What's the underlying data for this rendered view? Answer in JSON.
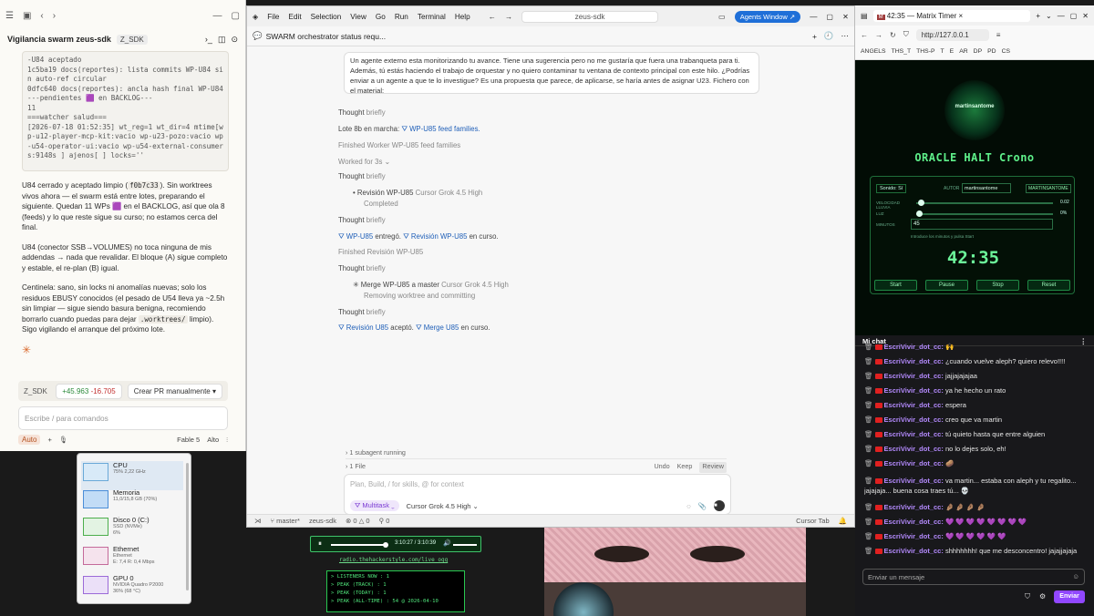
{
  "left": {
    "title": "Vigilancia swarm zeus-sdk",
    "branch_badge": "Z_SDK",
    "code_lines": "-U84 aceptado\n1c5ba19 docs(reportes): lista commits WP-U84 sin auto-ref circular\n0dfc640 docs(reportes): ancla hash final WP-U84\n---pendientes 🟪 en BACKLOG---\n11\n===watcher salud===\n[2026-07-18 01:52:35] wt_reg=1 wt_dir=4 mtime[wp-u12-player-mcp-kit:vacio wp-u23-pozo:vacio wp-u54-operator-ui:vacio wp-u54-external-consumers:9148s ] ajenos[ ] locks=''",
    "para1_a": "U84 cerrado y aceptado limpio (",
    "para1_code": "f0b7c33",
    "para1_b": "). Sin worktrees vivos ahora — el swarm está entre lotes, preparando el siguiente. Quedan 11 WPs 🟪 en el BACKLOG, así que ola 8 (feeds) y lo que reste sigue su curso; no estamos cerca del final.",
    "para2": "U84 (conector SSB→VOLUMES) no toca ninguna de mis addendas → nada que revalidar. El bloque (A) sigue completo y estable, el re-plan (B) igual.",
    "para3_a": "Centinela: sano, sin locks ni anomalías nuevas; solo los residuos EBUSY conocidos (el pesado de U54 lleva ya ~2.5h sin limpiar — sigue siendo basura benigna, recomiendo borrarlo cuando puedas para dejar ",
    "para3_code": ".worktrees/",
    "para3_b": " limpio). Sigo vigilando el arranque del próximo lote.",
    "repo_chip": "Z_SDK",
    "diff_add": "+45.963",
    "diff_del": "-16.705",
    "pr_button": "Crear PR manualmente",
    "input_placeholder": "Escribe / para comandos",
    "mode": "Auto",
    "model": "Fable 5",
    "effort": "Alto"
  },
  "mid": {
    "menu": [
      "File",
      "Edit",
      "Selection",
      "View",
      "Go",
      "Run",
      "Terminal",
      "Help"
    ],
    "search": "zeus-sdk",
    "agents_button": "Agents Window ↗",
    "tab_title": "SWARM orchestrator status requ...",
    "message": "Un agente externo esta monitorizando tu avance. Tiene una sugerencia pero no me gustaría que fuera una trabanqueta para ti. Además, tú estás haciendo el trabajo de orquestar y no quiero contaminar tu ventana de contexto principal con este hilo. ¿Podrías enviar a un agente a que te lo investigue? Es una propuesta que parece, de aplicarse, se haría antes de asignar U23. Fichero con el material:",
    "thought": "Thought",
    "briefly": "briefly",
    "lote_text": "Lote 8b en marcha:",
    "lote_link": "WP-U85 feed families.",
    "finished1": "Finished Worker WP-U85 feed families",
    "worked": "Worked for 3s",
    "rev_title": "Revisión WP-U85",
    "rev_model": "Cursor Grok 4.5 High",
    "rev_status": "Completed",
    "entrego_link1": "WP-U85",
    "entrego_text": "entregó.",
    "entrego_link2": "Revisión WP-U85",
    "entrego_tail": "en curso.",
    "finished2": "Finished Revisión WP-U85",
    "merge_title": "Merge WP-U85 a master",
    "merge_model": "Cursor Grok 4.5 High",
    "merge_status": "Removing worktree and committing",
    "acepto_link1": "Revisión U85",
    "acepto_text": "aceptó.",
    "acepto_link2": "Merge U85",
    "acepto_tail": "en curso.",
    "subagent": "1 subagent running",
    "files": "1 File",
    "undo": "Undo",
    "keep": "Keep",
    "review": "Review",
    "composer_placeholder": "Plan, Build, / for skills, @ for context",
    "multitask": "Multitask",
    "composer_model": "Cursor Grok 4.5 High",
    "status_branch": "master*",
    "status_repo": "zeus-sdk",
    "status_errors": "⊗ 0 △ 0",
    "status_ports": "0",
    "status_right": "Cursor Tab"
  },
  "right": {
    "tab_title": "42:35 — Matrix Timer",
    "url": "http://127.0.0.1",
    "bookmarks": [
      "ANGELS",
      "THS_T",
      "THS-P",
      "T",
      "E",
      "AR",
      "DP",
      "PD",
      "CS"
    ],
    "avatar_name": "martinsantome",
    "crono_title": "ORACLE HALT Crono",
    "sonido": "Sonido: Sí",
    "autor_label": "AUTOR",
    "autor_value": "martinsantome",
    "autor_tag": "MARTINSANTOME",
    "velocidad": "VELOCIDAD LLUVIA",
    "vel_value": "0.02",
    "luz": "LUZ",
    "luz_value": "0%",
    "minutos": "MINUTOS",
    "min_value": "45",
    "hint": "Introduce los minutos y pulsa Start",
    "timer": "42:35",
    "buttons": [
      "Start",
      "Pause",
      "Stop",
      "Reset"
    ],
    "chat_title": "Mi chat",
    "user": "EscriVivir_dot_cc:",
    "messages": [
      "🙌",
      "¿cuando vuelve aleph? quiero relevo!!!!",
      "jajjajajajaa",
      "ya he hecho un rato",
      "espera",
      "creo que va martin",
      "tú quieto hasta que entre alguien",
      "no lo dejes solo, eh!",
      "🥔",
      "va martin... estaba con aleph y tu regalito... jajajaja... buena cosa traes tú... 💀",
      "🤌🏽 🤌🏽 🤌🏽 🤌🏽",
      "💜 💜 💜 💜 💜 💜 💜 💜",
      "💜 💜 💜 💜 💜 💜",
      "shhhhhhh! que me desconcentro! jajajjajaja"
    ],
    "chat_placeholder": "Enviar un mensaje",
    "send": "Enviar"
  },
  "taskman": {
    "items": [
      {
        "name": "CPU",
        "sub": "75% 2,22 GHz"
      },
      {
        "name": "Memoria",
        "sub": "11,0/15,8 GB (70%)"
      },
      {
        "name": "Disco 0 (C:)",
        "sub": "SSD (NVMe)\n6%"
      },
      {
        "name": "Ethernet",
        "sub": "Ethernet\nE: 7,4 R: 0,4 Mbps"
      },
      {
        "name": "GPU 0",
        "sub": "NVIDIA Quadro P2000\n36% (68 °C)"
      }
    ]
  },
  "player": {
    "time": "3:10:27 / 3:10:39",
    "stream": "radio.thehackerstyle.com/live_ogg",
    "stats": [
      "> LISTENERS NOW   : 1",
      "> PEAK (TRACK)    : 1",
      "> PEAK (TODAY)    : 1",
      "> PEAK (ALL-TIME) : 54 @ 2026-04-10"
    ]
  },
  "colors": {
    "accent": "#1f6fd8",
    "matrix": "#3fe077",
    "twitch": "#9147ff"
  }
}
